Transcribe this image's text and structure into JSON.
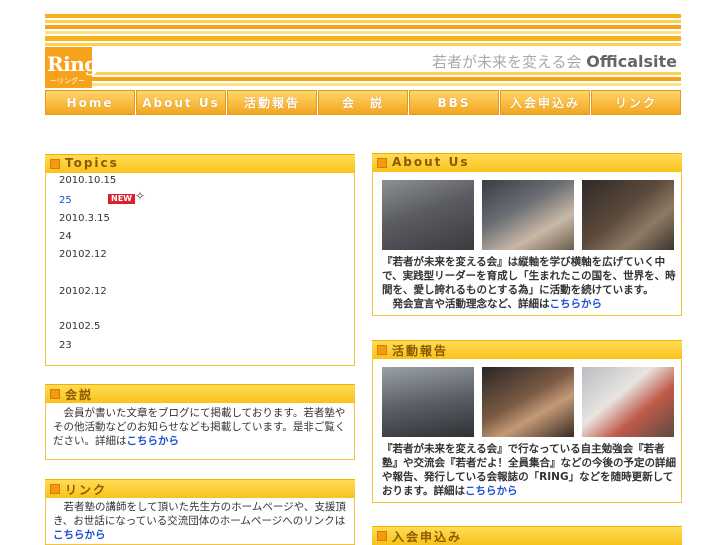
{
  "header": {
    "logo_text": "Ring",
    "logo_sub": "ーリングー",
    "tagline": "若者が未来を変える会",
    "tagline_bold": "Officalsite"
  },
  "nav": [
    {
      "label": "Home"
    },
    {
      "label": "About Us"
    },
    {
      "label": "活動報告"
    },
    {
      "label": "会　説"
    },
    {
      "label": "BBS"
    },
    {
      "label": "入会申込み"
    },
    {
      "label": "リンク"
    }
  ],
  "topics": {
    "title": "Topics",
    "items": [
      {
        "text": "2010.10.15"
      },
      {
        "text": "25"
      },
      {
        "text": "2010.3.15"
      },
      {
        "text": "24"
      },
      {
        "text": "20102.12"
      },
      {
        "text": "20102.12"
      },
      {
        "text": "20102.5"
      },
      {
        "text": "23"
      }
    ],
    "new_badge": "NEW"
  },
  "kaisetsu": {
    "title": "会説",
    "body": "会員が書いた文章をブログにて掲載しております。若者塾やその他活動などのお知らせなども掲載しています。是非ご覧ください。詳細は",
    "link": "こちらから"
  },
  "link_section": {
    "title": "リンク",
    "body": "若者塾の講師をして頂いた先生方のホームページや、支援頂き、お世話になっている交流団体のホームページへのリンクは",
    "link": "こちらから"
  },
  "about": {
    "title": "About Us",
    "body": "『若者が未来を変える会』は縦軸を学び横軸を広げていく中で、実践型リーダーを育成し「生まれたこの国を、世界を、時間を、愛し誇れるものとする為」に活動を続けています。",
    "body2": "発会宣言や活動理念など、詳細は",
    "link": "こちらから"
  },
  "report": {
    "title": "活動報告",
    "body": "『若者が未来を変える会』で行なっている自主勉強会『若者塾』や交流会『若者だよ！全員集合』などの今後の予定の詳細や報告、発行している会報誌の「RING」などを随時更新しております。詳細は",
    "link": "こちらから"
  },
  "join": {
    "title": "入会申込み"
  },
  "colors": {
    "accent": "#f7a21b",
    "header_yellow": "#ffd64a",
    "link_blue": "#1a4fd0"
  }
}
